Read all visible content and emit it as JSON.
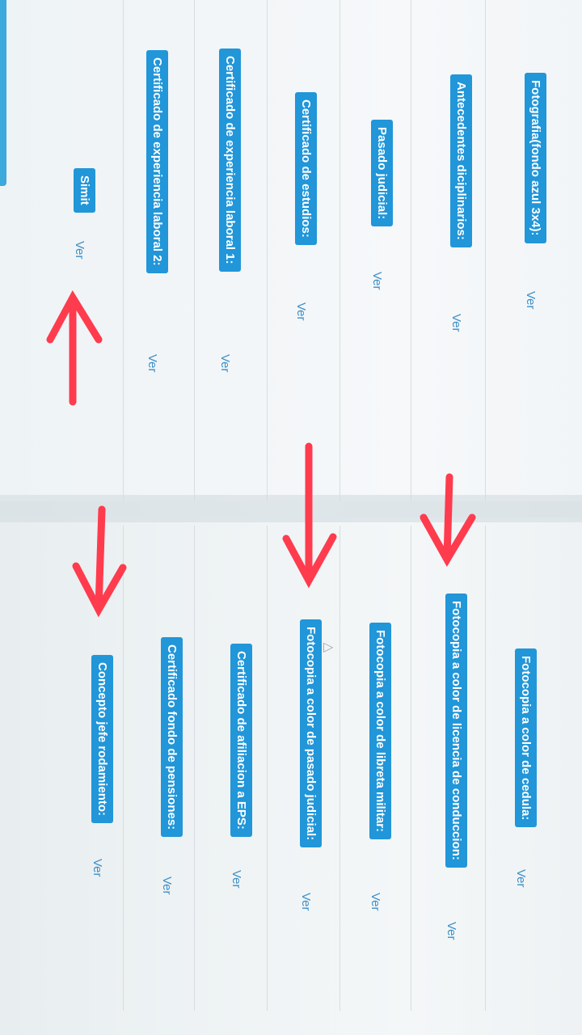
{
  "documents_left": [
    {
      "label": "Fotografia(fondo azul 3x4):",
      "link": "Ver"
    },
    {
      "label": "Antecedentes diciplinarios:",
      "link": "Ver"
    },
    {
      "label": "Pasado judicial:",
      "link": "Ver"
    },
    {
      "label": "Certificado de estudios:",
      "link": "Ver"
    },
    {
      "label": "Certificado de experiencia laboral 1:",
      "link": "Ver"
    },
    {
      "label": "Certificado de experiencia laboral 2:",
      "link": "Ver"
    },
    {
      "label": "Simit",
      "link": "Ver"
    }
  ],
  "documents_right": [
    {
      "label": "Fotocopia a color de cedula:",
      "link": "Ver"
    },
    {
      "label": "Fotocopia a color de licencia de conduccion:",
      "link": "Ver"
    },
    {
      "label": "Fotocopia a color de libreta militar:",
      "link": "Ver"
    },
    {
      "label": "Fotocopia a color de pasado judicial:",
      "link": "Ver"
    },
    {
      "label": "Certificado de afiliacion a EPS:",
      "link": "Ver"
    },
    {
      "label": "Certificado fondo de pensiones:",
      "link": "Ver"
    },
    {
      "label": "Concepto jefe rodamiento:",
      "link": "Ver"
    }
  ],
  "colors": {
    "badge": "#2196d9",
    "link": "#3d8fc7",
    "annotation_arrow": "#ff3b4e"
  }
}
